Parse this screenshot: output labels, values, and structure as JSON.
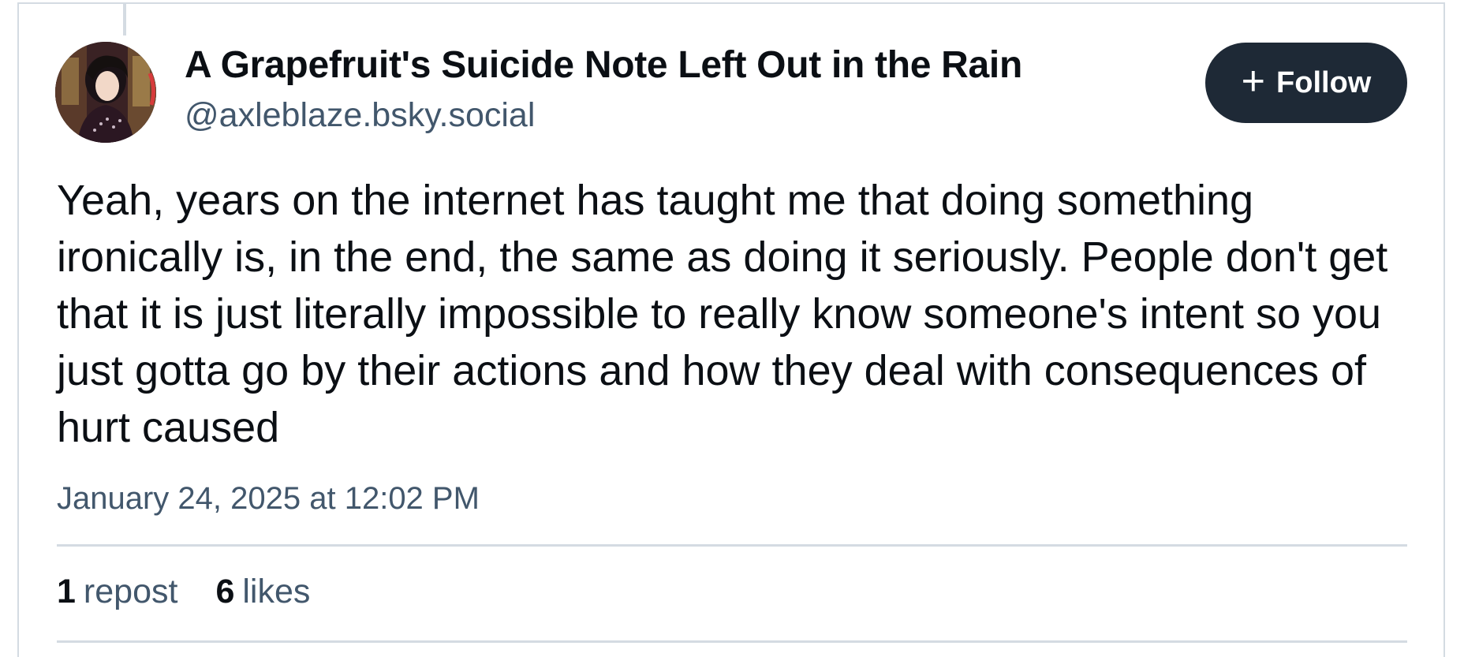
{
  "post": {
    "author": {
      "display_name": "A Grapefruit's Suicide Note Left Out in the Rain",
      "handle": "@axleblaze.bsky.social"
    },
    "follow_button": {
      "icon": "plus-icon",
      "label": "Follow"
    },
    "text": "Yeah, years on the internet has taught me that doing something ironically is, in the end, the same as doing it seriously. People don't get that it is just literally impossible to really know someone's intent so you just gotta go by their actions and how they deal with consequences of hurt caused",
    "timestamp": "January 24, 2025 at 12:02 PM",
    "stats": {
      "reposts": {
        "count": "1",
        "label": "repost"
      },
      "likes": {
        "count": "6",
        "label": "likes"
      }
    }
  },
  "colors": {
    "follow_button_bg": "#1e2936",
    "secondary_text": "#42576c",
    "border": "#d4dbe2"
  }
}
